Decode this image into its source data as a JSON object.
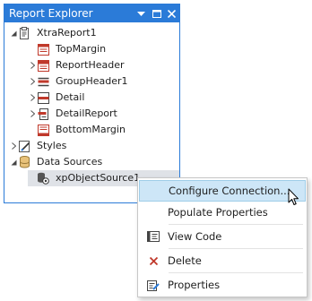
{
  "panel": {
    "title": "Report Explorer"
  },
  "tree": {
    "root": "XtraReport1",
    "bands": [
      {
        "label": "TopMargin",
        "icon": "top-margin-band-icon"
      },
      {
        "label": "ReportHeader",
        "icon": "report-header-band-icon"
      },
      {
        "label": "GroupHeader1",
        "icon": "group-header-band-icon"
      },
      {
        "label": "Detail",
        "icon": "detail-band-icon"
      },
      {
        "label": "DetailReport",
        "icon": "detail-report-band-icon"
      },
      {
        "label": "BottomMargin",
        "icon": "bottom-margin-band-icon"
      }
    ],
    "styles": "Styles",
    "data_sources": "Data Sources",
    "source": "xpObjectSource1"
  },
  "context_menu": {
    "items": [
      {
        "label": "Configure Connection...",
        "icon": ""
      },
      {
        "label": "Populate Properties",
        "icon": ""
      },
      {
        "label": "View Code",
        "icon": "code-view-icon"
      },
      {
        "label": "Delete",
        "icon": "delete-x-icon"
      },
      {
        "label": "Properties",
        "icon": "properties-icon"
      }
    ]
  },
  "colors": {
    "accent": "#2b7bd8",
    "hover": "#cde6f7",
    "band": "#c0392b",
    "delete": "#c0392b"
  }
}
